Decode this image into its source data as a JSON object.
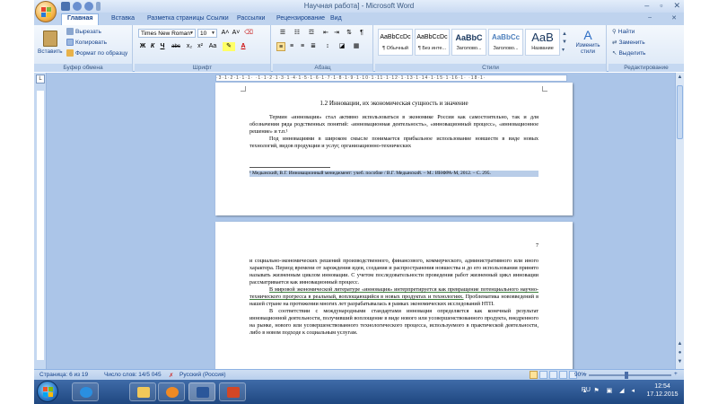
{
  "window": {
    "title": "Научная работа] - Microsoft Word",
    "minimize": "–",
    "maximize": "▫",
    "close": "✕",
    "ribbon_min": "–",
    "ribbon_close": "✕"
  },
  "tabs": [
    "Главная",
    "Вставка",
    "Разметка страницы",
    "Ссылки",
    "Рассылки",
    "Рецензирование",
    "Вид"
  ],
  "clipboard": {
    "paste": "Вставить",
    "cut": "Вырезать",
    "copy": "Копировать",
    "format_painter": "Формат по образцу",
    "label": "Буфер обмена"
  },
  "font": {
    "family": "Times New Roman",
    "size": "10",
    "grow": "A˄",
    "shrink": "A˅",
    "bold": "Ж",
    "italic": "К",
    "underline": "Ч",
    "strike": "abc",
    "sub": "x₂",
    "sup": "x²",
    "case": "Aa",
    "label": "Шрифт"
  },
  "paragraph": {
    "label": "Абзац"
  },
  "styles": {
    "items": [
      {
        "sample": "AaBbCcDc",
        "name": "¶ Обычный"
      },
      {
        "sample": "AaBbCcDc",
        "name": "¶ Без инте..."
      },
      {
        "sample": "AaBbC",
        "name": "Заголово..."
      },
      {
        "sample": "AaBbCc",
        "name": "Заголово..."
      },
      {
        "sample": "AaB",
        "name": "Название"
      }
    ],
    "change": "Изменить стили",
    "label": "Стили"
  },
  "editing": {
    "find": "Найти",
    "replace": "Заменить",
    "select": "Выделить",
    "label": "Редактирование"
  },
  "ruler": {
    "marks": "·3·1·2·1·1·1· ·1·1·2·1·3·1·4·1·5·1·6·1·7·1·8·1·9·1·10·1·11·1·12·1·13·1·14·1·15·1·16·1· ·18·1·"
  },
  "page1": {
    "heading": "1.2 Инновации, их экономическая сущность и значение",
    "paragraphs": [
      "Термин «инновация» стал активно использоваться в экономике России как самостоятельно, так и для обозначения ряда родственных понятий: «инновационная деятельность», «инновационный процесс», «инновационное решение» и т.п.¹",
      "Под инновациями в широком смысле понимается прибыльное использование новшеств в виде новых технологий, видов продукции и услуг, организационно-технических"
    ],
    "footnote": "¹ Медынский, В.Г. Инновационный менеджмент: учеб. пособие / В.Г. Медынский. – М.: ИНФРА-М, 2012. – С. 295."
  },
  "page2": {
    "page_number": "7",
    "lead": "и социально-экономических решений производственного, финансового, коммерческого, административного или иного характера. Период времени от зарождения идеи, создания и распространения новшества и до его использования принято называть жизненным циклом инновации. С учетом последовательности проведения работ жизненный цикл инновации рассматривается как инновационный процесс.",
    "p2_underlined": "В мировой экономической литературе «инновация» интерпретируется как превращение потенциального научно-технического прогресса в реальный, воплощающийся в новых продуктах и технологиях.",
    "p2_rest": " Проблематика нововведений в нашей стране на протяжении многих лет разрабатывалась в рамках экономических исследований НТП.",
    "p3": "В соответствии с международными стандартами инновация определяется как конечный результат инновационной деятельности, получивший воплощение в виде нового или усовершенствованного продукта, внедренного на рынке, нового или усовершенствованного технологического процесса, используемого в практической деятельности, либо в новом подходе к социальным услугам."
  },
  "statusbar": {
    "page": "Страница: 6 из 19",
    "words": "Число слов: 14/5 045",
    "lang": "Русский (Россия)",
    "zoom": "90%",
    "zoom_minus": "–",
    "zoom_plus": "+"
  },
  "taskbar": {
    "lang": "RU",
    "time": "12:54",
    "date": "17.12.2015"
  },
  "colors": {
    "ribbon_text": "#15428b",
    "word_blue": "#2b579a",
    "powerpoint": "#d24726",
    "selection": "#b9cde8"
  }
}
